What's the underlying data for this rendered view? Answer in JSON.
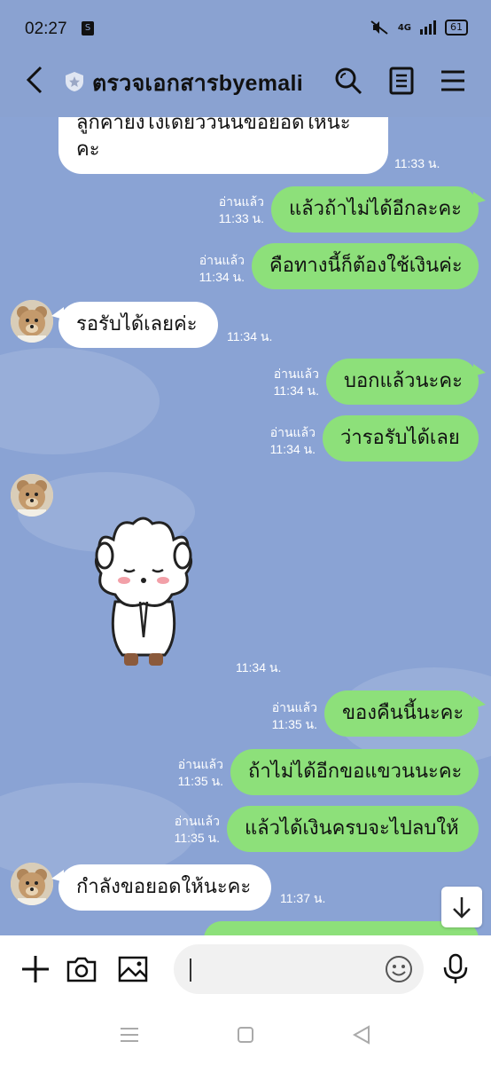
{
  "status": {
    "time": "02:27",
    "network": "4G",
    "battery": "61"
  },
  "header": {
    "title": "ตรวจเอกสารbyemali"
  },
  "messages": {
    "m1": {
      "text_line1": "ลูกค้ายังไงเดี๋ยววันนี้ขอยอดให้นะ",
      "text_line2": "คะ",
      "time": "11:33 น."
    },
    "m2": {
      "read": "อ่านแล้ว",
      "time": "11:33 น.",
      "text": "แล้วถ้าไม่ได้อีกละคะ"
    },
    "m3": {
      "read": "อ่านแล้ว",
      "time": "11:34 น.",
      "text": "คือทางนี้ก็ต้องใช้เงินค่ะ"
    },
    "m4": {
      "text": "รอรับได้เลยค่ะ",
      "time": "11:34 น."
    },
    "m5": {
      "read": "อ่านแล้ว",
      "time": "11:34 น.",
      "text": "บอกแล้วนะคะ"
    },
    "m6": {
      "read": "อ่านแล้ว",
      "time": "11:34 น.",
      "text": "ว่ารอรับได้เลย"
    },
    "m7": {
      "time": "11:34 น."
    },
    "m8": {
      "read": "อ่านแล้ว",
      "time": "11:35 น.",
      "text": "ของคืนนี้นะคะ"
    },
    "m9": {
      "read": "อ่านแล้ว",
      "time": "11:35 น.",
      "text": "ถ้าไม่ได้อีกขอแขวนนะคะ"
    },
    "m10": {
      "read": "อ่านแล้ว",
      "time": "11:35 น.",
      "text": "แล้วได้เงินครบจะไปลบให้"
    },
    "m11": {
      "text": "กำลังขอยอดให้นะคะ",
      "time": "11:37 น."
    }
  },
  "composer": {
    "placeholder": ""
  },
  "colors": {
    "chat_bg": "#8aa3d4",
    "outgoing": "#8de07a",
    "incoming": "#ffffff"
  }
}
